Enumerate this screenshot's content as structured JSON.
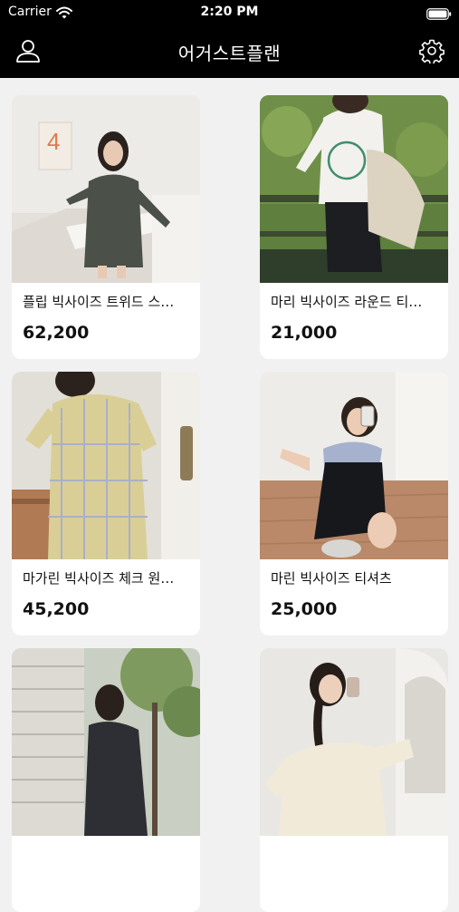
{
  "status_bar": {
    "carrier": "Carrier",
    "time": "2:20 PM",
    "wifi_icon": "wifi-icon",
    "battery_icon": "battery-icon"
  },
  "nav": {
    "title": "어거스트플랜",
    "left_icon": "person-icon",
    "right_icon": "gear-icon"
  },
  "products": [
    {
      "name": "플립 빅사이즈 트위드 스…",
      "price": "62,200"
    },
    {
      "name": "마리 빅사이즈 라운드 티…",
      "price": "21,000"
    },
    {
      "name": "마가린 빅사이즈 체크 원…",
      "price": "45,200"
    },
    {
      "name": "마린 빅사이즈 티셔츠",
      "price": "25,000"
    },
    {
      "name": "",
      "price": ""
    },
    {
      "name": "",
      "price": ""
    }
  ]
}
